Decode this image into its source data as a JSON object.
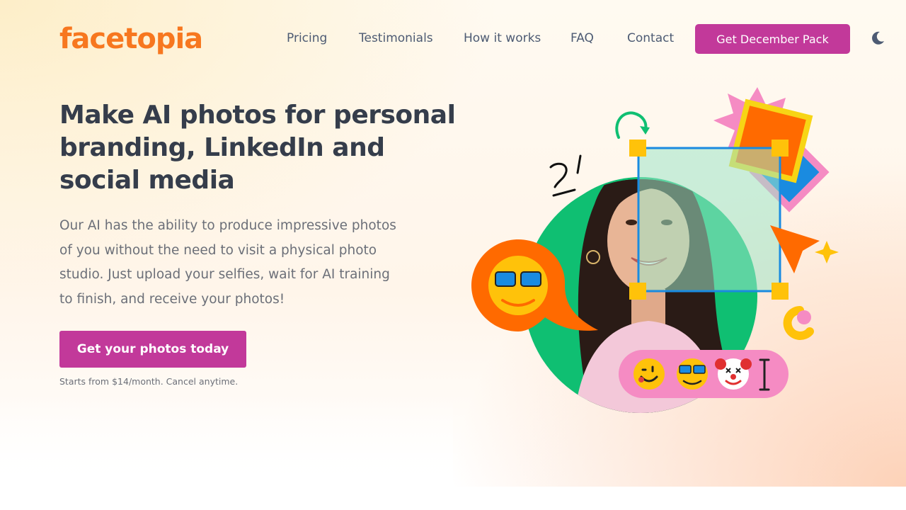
{
  "brand": {
    "name": "facetopia",
    "color": "#f7771f"
  },
  "nav": {
    "items": [
      {
        "label": "Pricing"
      },
      {
        "label": "Testimonials"
      },
      {
        "label": "How it works"
      },
      {
        "label": "FAQ"
      },
      {
        "label": "Contact"
      }
    ],
    "cta_label": "Get December Pack",
    "theme_toggle_icon": "moon-icon"
  },
  "hero": {
    "title": "Make AI photos for personal branding, LinkedIn and social media",
    "description": "Our AI has the ability to produce impressive photos of you without the need to visit a physical photo studio. Just upload your selfies, wait for AI training to finish, and receive your photos!",
    "cta_label": "Get your photos today",
    "fine_print": "Starts from $14/month. Cancel anytime."
  },
  "colors": {
    "accent": "#c2399a",
    "heading": "#353d4b",
    "nav_text": "#4d5b73",
    "body_text": "#6b6f78"
  },
  "illustration": {
    "emoji_bar": [
      "wink-emoji-icon",
      "sunglasses-emoji-icon",
      "clown-emoji-icon",
      "text-cursor-icon"
    ],
    "bubble_icon": "sunglasses-emoji-icon"
  }
}
